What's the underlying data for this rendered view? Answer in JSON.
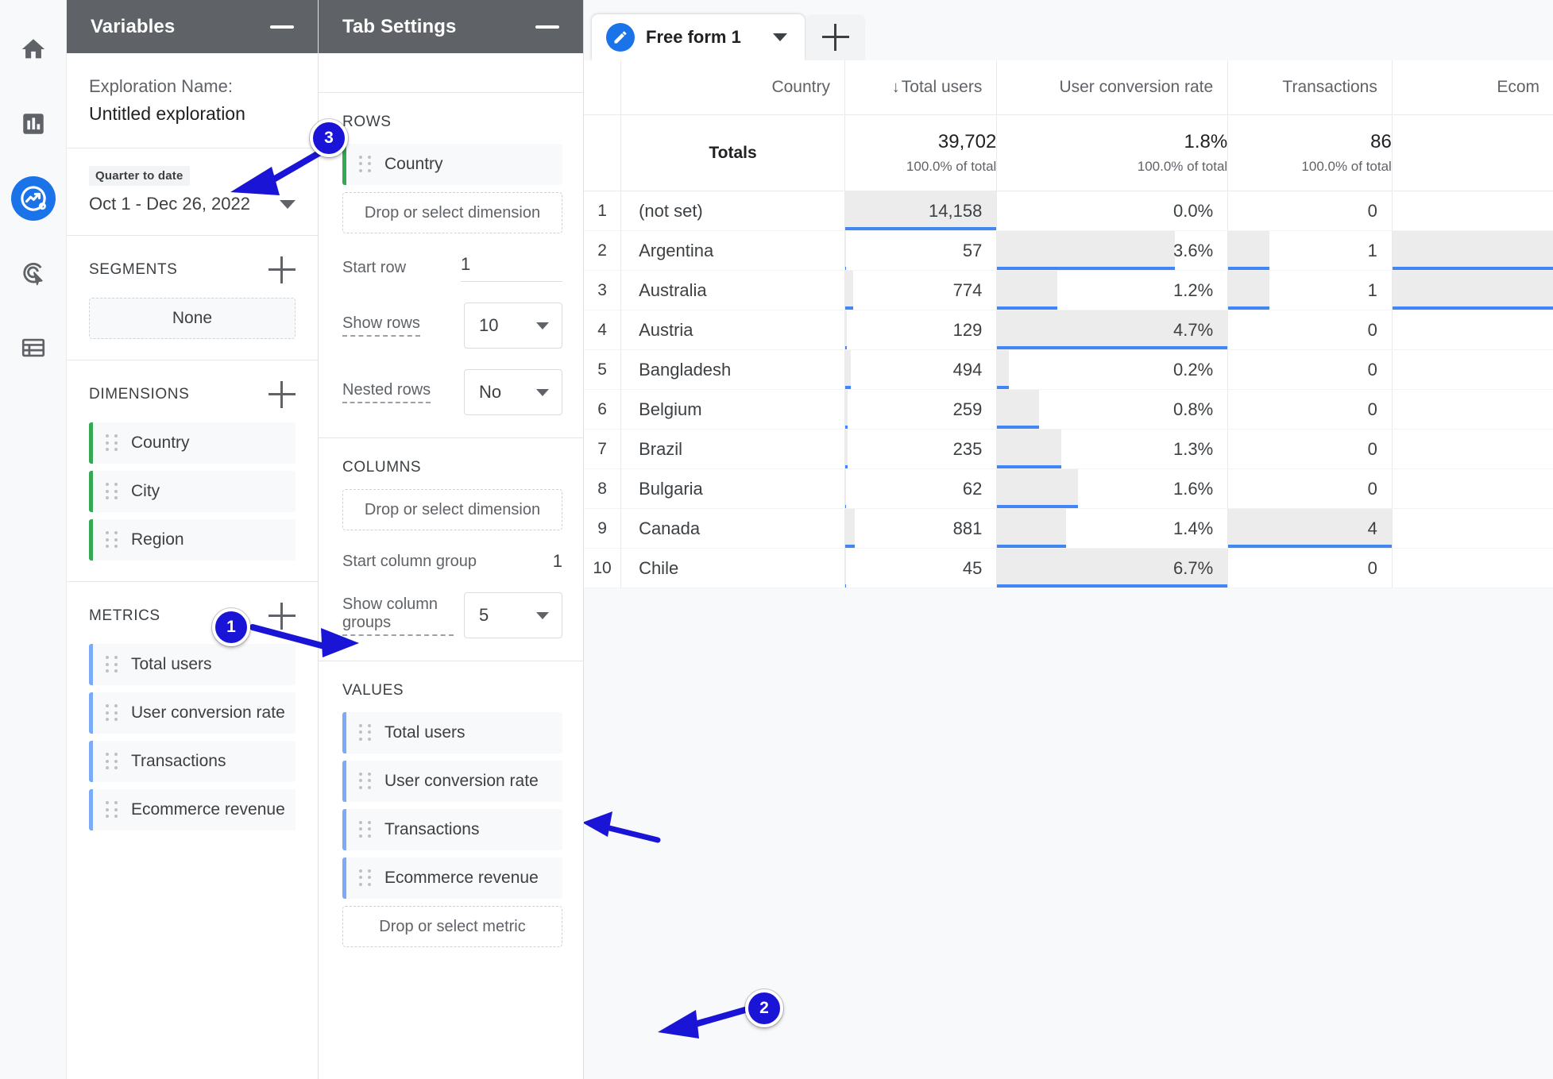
{
  "rail": {
    "items": [
      {
        "name": "home-icon",
        "label": "Home",
        "active": false
      },
      {
        "name": "reports-icon",
        "label": "Reports",
        "active": false
      },
      {
        "name": "explore-icon",
        "label": "Explore",
        "active": true
      },
      {
        "name": "advertising-icon",
        "label": "Advertising",
        "active": false
      },
      {
        "name": "library-icon",
        "label": "Library",
        "active": false
      }
    ]
  },
  "variables": {
    "title": "Variables",
    "minimize_label": "Minimize",
    "exploration_label": "Exploration Name:",
    "exploration_name": "Untitled exploration",
    "date_chip": "Quarter to date",
    "date_range": "Oct 1 - Dec 26, 2022",
    "segments": {
      "title": "SEGMENTS",
      "add_label": "+",
      "none": "None"
    },
    "dimensions": {
      "title": "DIMENSIONS",
      "add_label": "+",
      "items": [
        "Country",
        "City",
        "Region"
      ]
    },
    "metrics": {
      "title": "METRICS",
      "add_label": "+",
      "items": [
        "Total users",
        "User conversion rate",
        "Transactions",
        "Ecommerce revenue"
      ]
    }
  },
  "tab_settings": {
    "title": "Tab Settings",
    "minimize_label": "Minimize",
    "rows": {
      "title": "ROWS",
      "items": [
        "Country"
      ],
      "dropzone": "Drop or select dimension",
      "start_row_label": "Start row",
      "start_row_value": "1",
      "show_rows_label": "Show rows",
      "show_rows_value": "10",
      "nested_rows_label": "Nested rows",
      "nested_rows_value": "No"
    },
    "columns": {
      "title": "COLUMNS",
      "dropzone": "Drop or select dimension",
      "start_group_label": "Start column group",
      "start_group_value": "1",
      "show_groups_label": "Show column groups",
      "show_groups_value": "5"
    },
    "values": {
      "title": "VALUES",
      "items": [
        "Total users",
        "User conversion rate",
        "Transactions",
        "Ecommerce revenue"
      ],
      "dropzone": "Drop or select metric"
    }
  },
  "canvas": {
    "tab_label": "Free form 1",
    "tab_edit_icon": "pencil-icon",
    "tab_caret_icon": "chevron-down-icon",
    "add_tab_label": "+"
  },
  "chart_data": {
    "type": "table",
    "title": "Free form 1",
    "columns": [
      {
        "key": "rank",
        "label": "",
        "align": "center",
        "sorted": false
      },
      {
        "key": "country",
        "label": "Country",
        "align": "left",
        "sorted": false
      },
      {
        "key": "users",
        "label": "Total users",
        "align": "right",
        "sorted": true,
        "sort_dir": "desc",
        "sort_glyph": "↓"
      },
      {
        "key": "ucr",
        "label": "User conversion rate",
        "align": "right",
        "sorted": false
      },
      {
        "key": "txn",
        "label": "Transactions",
        "align": "right",
        "sorted": false
      },
      {
        "key": "ecom",
        "label": "Ecom",
        "align": "right",
        "sorted": false
      }
    ],
    "totals": {
      "label": "Totals",
      "users": {
        "value": "39,702",
        "sub": "100.0% of total"
      },
      "ucr": {
        "value": "1.8%",
        "sub": "100.0% of total"
      },
      "txn": {
        "value": "86",
        "sub": "100.0% of total"
      },
      "ecom": {
        "value": "",
        "sub": ""
      }
    },
    "rows": [
      {
        "rank": "1",
        "country": "(not set)",
        "users": "14,158",
        "users_pct": 100,
        "ucr": "0.0%",
        "ucr_pct": 0,
        "txn": "0",
        "txn_pct": 0,
        "ecom_pct": 0
      },
      {
        "rank": "2",
        "country": "Argentina",
        "users": "57",
        "users_pct": 0.4,
        "ucr": "3.6%",
        "ucr_pct": 77,
        "txn": "1",
        "txn_pct": 25,
        "ecom_pct": 100
      },
      {
        "rank": "3",
        "country": "Australia",
        "users": "774",
        "users_pct": 5.5,
        "ucr": "1.2%",
        "ucr_pct": 26,
        "txn": "1",
        "txn_pct": 25,
        "ecom_pct": 100
      },
      {
        "rank": "4",
        "country": "Austria",
        "users": "129",
        "users_pct": 0.9,
        "ucr": "4.7%",
        "ucr_pct": 100,
        "txn": "0",
        "txn_pct": 0,
        "ecom_pct": 0
      },
      {
        "rank": "5",
        "country": "Bangladesh",
        "users": "494",
        "users_pct": 3.5,
        "ucr": "0.2%",
        "ucr_pct": 5,
        "txn": "0",
        "txn_pct": 0,
        "ecom_pct": 0
      },
      {
        "rank": "6",
        "country": "Belgium",
        "users": "259",
        "users_pct": 1.8,
        "ucr": "0.8%",
        "ucr_pct": 18,
        "txn": "0",
        "txn_pct": 0,
        "ecom_pct": 0
      },
      {
        "rank": "7",
        "country": "Brazil",
        "users": "235",
        "users_pct": 1.7,
        "ucr": "1.3%",
        "ucr_pct": 28,
        "txn": "0",
        "txn_pct": 0,
        "ecom_pct": 0
      },
      {
        "rank": "8",
        "country": "Bulgaria",
        "users": "62",
        "users_pct": 0.4,
        "ucr": "1.6%",
        "ucr_pct": 35,
        "txn": "0",
        "txn_pct": 0,
        "ecom_pct": 0
      },
      {
        "rank": "9",
        "country": "Canada",
        "users": "881",
        "users_pct": 6.2,
        "ucr": "1.4%",
        "ucr_pct": 30,
        "txn": "4",
        "txn_pct": 100,
        "ecom_pct": 0
      },
      {
        "rank": "10",
        "country": "Chile",
        "users": "45",
        "users_pct": 0.3,
        "ucr": "6.7%",
        "ucr_pct": 100,
        "txn": "0",
        "txn_pct": 0,
        "ecom_pct": 0
      }
    ],
    "bar_color": "#ececec",
    "underline_color": "#4285f4"
  },
  "callouts": [
    {
      "number": "1",
      "target": "metrics-add-button"
    },
    {
      "number": "2",
      "target": "values-drop-metric"
    },
    {
      "number": "3",
      "target": "date-range-selector"
    }
  ]
}
